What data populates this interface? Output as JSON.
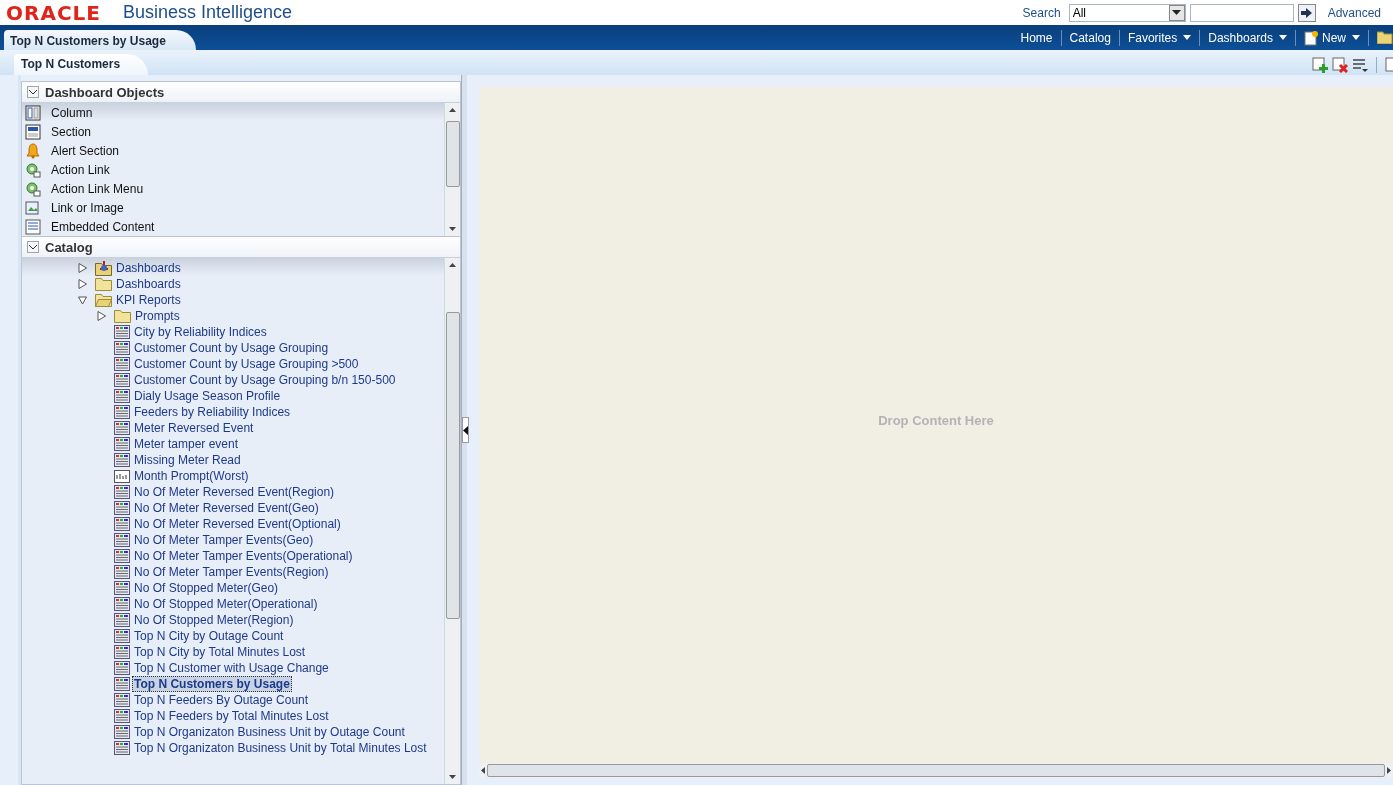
{
  "header": {
    "logo": "ORACLE",
    "product": "Business Intelligence",
    "search_label": "Search",
    "search_scope": "All",
    "advanced": "Advanced"
  },
  "page_tab": {
    "label": "Top N Customers by Usage"
  },
  "nav": [
    {
      "label": "Home",
      "dropdown": false,
      "kind": "link"
    },
    {
      "label": "Catalog",
      "dropdown": false,
      "kind": "link"
    },
    {
      "label": "Favorites",
      "dropdown": true,
      "kind": "link"
    },
    {
      "label": "Dashboards",
      "dropdown": true,
      "kind": "link"
    },
    {
      "label": "New",
      "dropdown": true,
      "kind": "new"
    }
  ],
  "sub_tab": {
    "label": "Top N Customers"
  },
  "dashboard_objects": {
    "title": "Dashboard Objects",
    "expanded": true,
    "items": [
      {
        "label": "Column",
        "kind": "column"
      },
      {
        "label": "Section",
        "kind": "section"
      },
      {
        "label": "Alert Section",
        "kind": "alert"
      },
      {
        "label": "Action Link",
        "kind": "action"
      },
      {
        "label": "Action Link Menu",
        "kind": "action"
      },
      {
        "label": "Link or Image",
        "kind": "link"
      },
      {
        "label": "Embedded Content",
        "kind": "embed"
      }
    ]
  },
  "catalog": {
    "title": "Catalog",
    "expanded": true,
    "items": [
      {
        "label": "Dashboards",
        "kind": "dashboard-folder",
        "expanded": false,
        "selected": false
      },
      {
        "label": "Dashboards",
        "kind": "folder",
        "expanded": false,
        "selected": false
      },
      {
        "label": "KPI Reports",
        "kind": "folder",
        "expanded": true,
        "selected": false,
        "children": [
          {
            "label": "Prompts",
            "kind": "folder",
            "expanded": false,
            "selected": false
          },
          {
            "label": "City by Reliability Indices",
            "kind": "report",
            "selected": false
          },
          {
            "label": "Customer Count by Usage Grouping",
            "kind": "report",
            "selected": false
          },
          {
            "label": "Customer Count by Usage Grouping >500",
            "kind": "report",
            "selected": false
          },
          {
            "label": "Customer Count by Usage Grouping b/n 150-500",
            "kind": "report",
            "selected": false
          },
          {
            "label": "Dialy Usage Season Profile",
            "kind": "report",
            "selected": false
          },
          {
            "label": "Feeders by Reliability Indices",
            "kind": "report",
            "selected": false
          },
          {
            "label": "Meter Reversed Event",
            "kind": "report",
            "selected": false
          },
          {
            "label": "Meter tamper event",
            "kind": "report",
            "selected": false
          },
          {
            "label": "Missing Meter Read",
            "kind": "report",
            "selected": false
          },
          {
            "label": "Month Prompt(Worst)",
            "kind": "prompt",
            "selected": false
          },
          {
            "label": "No Of Meter Reversed Event(Region)",
            "kind": "report",
            "selected": false
          },
          {
            "label": "No Of Meter Reversed Event(Geo)",
            "kind": "report",
            "selected": false
          },
          {
            "label": "No Of Meter Reversed Event(Optional)",
            "kind": "report",
            "selected": false
          },
          {
            "label": "No Of Meter Tamper Events(Geo)",
            "kind": "report",
            "selected": false
          },
          {
            "label": "No Of Meter Tamper Events(Operational)",
            "kind": "report",
            "selected": false
          },
          {
            "label": "No Of Meter Tamper Events(Region)",
            "kind": "report",
            "selected": false
          },
          {
            "label": "No Of Stopped Meter(Geo)",
            "kind": "report",
            "selected": false
          },
          {
            "label": "No Of Stopped Meter(Operational)",
            "kind": "report",
            "selected": false
          },
          {
            "label": "No Of Stopped Meter(Region)",
            "kind": "report",
            "selected": false
          },
          {
            "label": "Top N City by Outage Count",
            "kind": "report",
            "selected": false
          },
          {
            "label": "Top N City by Total Minutes Lost",
            "kind": "report",
            "selected": false
          },
          {
            "label": "Top N Customer with Usage Change",
            "kind": "report",
            "selected": false
          },
          {
            "label": "Top N Customers by Usage",
            "kind": "report",
            "selected": true
          },
          {
            "label": "Top N Feeders By Outage Count",
            "kind": "report",
            "selected": false
          },
          {
            "label": "Top N Feeders by Total Minutes Lost",
            "kind": "report",
            "selected": false
          },
          {
            "label": "Top N Organizaton Business Unit by Outage Count",
            "kind": "report",
            "selected": false
          },
          {
            "label": "Top N Organizaton Business Unit by Total Minutes Lost",
            "kind": "report",
            "selected": false
          }
        ]
      }
    ]
  },
  "canvas": {
    "hint": "Drop Content Here"
  }
}
